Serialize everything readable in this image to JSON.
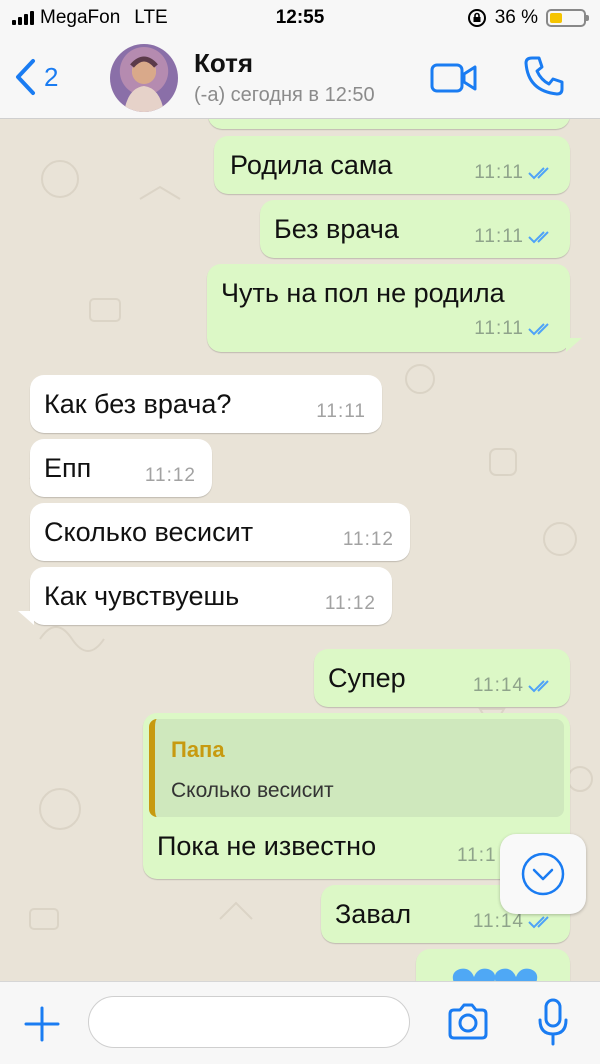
{
  "status_bar": {
    "carrier": "MegaFon",
    "network": "LTE",
    "time": "12:55",
    "battery": "36 %",
    "battery_level": 0.36
  },
  "header": {
    "back_count": "2",
    "contact_name": "Котя",
    "contact_status": "(-а) сегодня в 12:50"
  },
  "messages": [
    {
      "dir": "out",
      "text": "Родила сама",
      "time": "11:11"
    },
    {
      "dir": "out",
      "text": "Без врача",
      "time": "11:11"
    },
    {
      "dir": "out",
      "text": "Чуть на пол не родила",
      "time": "11:11"
    },
    {
      "dir": "in",
      "text": "Как без врача?",
      "time": "11:11"
    },
    {
      "dir": "in",
      "text": "Епп",
      "time": "11:12"
    },
    {
      "dir": "in",
      "text": "Сколько весисит",
      "time": "11:12"
    },
    {
      "dir": "in",
      "text": "Как чувствуешь",
      "time": "11:12"
    },
    {
      "dir": "out",
      "text": "Супер",
      "time": "11:14"
    },
    {
      "dir": "out",
      "text": "Пока не известно",
      "time": "11:1",
      "quote_author": "Папа",
      "quote_text": "Сколько весисит"
    },
    {
      "dir": "out",
      "text": "Завал",
      "time": "11:14"
    }
  ],
  "input": {
    "placeholder": ""
  },
  "colors": {
    "accent": "#1a7cf2",
    "outgoing": "#dcf8c6",
    "incoming": "#ffffff",
    "ticks": "#4fa3f7",
    "quote_author": "#c79a10"
  }
}
